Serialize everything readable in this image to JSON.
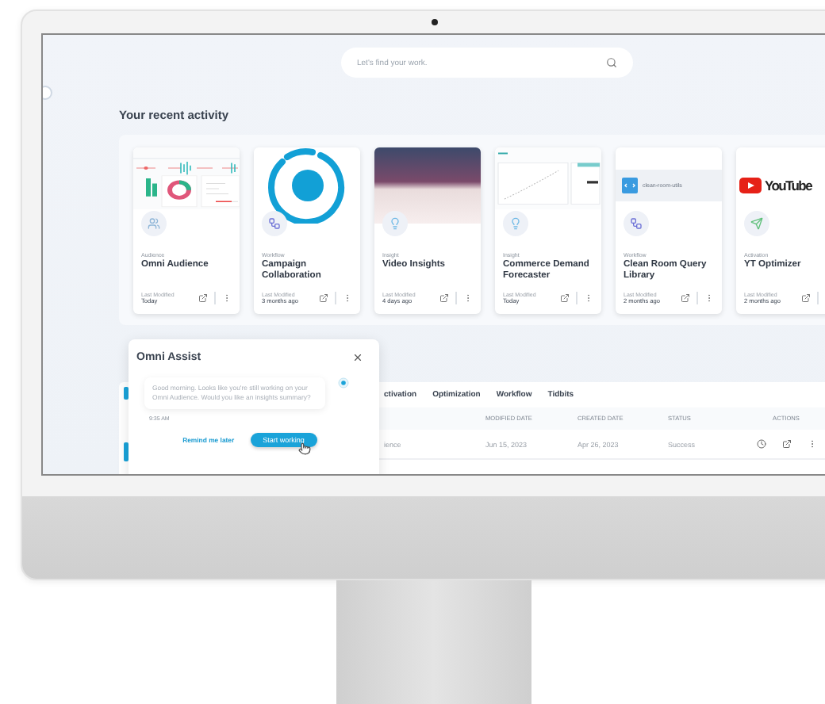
{
  "search": {
    "placeholder": "Let's find your work."
  },
  "recent_activity": {
    "title": "Your recent activity",
    "cards": [
      {
        "image": {
          "kind": "dashboard"
        },
        "kind": "audience",
        "category": "Audience",
        "title": "Omni Audience",
        "modified_label": "Last Modified",
        "modified": "Today"
      },
      {
        "image": {
          "kind": "ring-logo"
        },
        "kind": "workflow",
        "category": "Workflow",
        "title": "Campaign Collaboration",
        "modified_label": "Last Modified",
        "modified": "3 months ago"
      },
      {
        "image": {
          "kind": "photo"
        },
        "kind": "insight",
        "category": "Insight",
        "title": "Video Insights",
        "modified_label": "Last Modified",
        "modified": "4 days ago"
      },
      {
        "image": {
          "kind": "chart"
        },
        "kind": "insight",
        "category": "Insight",
        "title": "Commerce Demand Forecaster",
        "modified_label": "Last Modified",
        "modified": "Today"
      },
      {
        "image": {
          "kind": "file",
          "label": "clean-room-utils"
        },
        "kind": "workflow",
        "category": "Workflow",
        "title": "Clean Room Query Library",
        "modified_label": "Last Modified",
        "modified": "2 months ago"
      },
      {
        "image": {
          "kind": "video-logo",
          "label": "YouTube"
        },
        "kind": "activation",
        "category": "Activation",
        "title": "YT Optimizer",
        "modified_label": "Last Modified",
        "modified": "2 months ago"
      }
    ]
  },
  "table": {
    "tabs": [
      {
        "label": "ctivation"
      },
      {
        "label": "Optimization"
      },
      {
        "label": "Workflow"
      },
      {
        "label": "Tidbits"
      }
    ],
    "columns": [
      "MODIFIED DATE",
      "CREATED DATE",
      "STATUS",
      "ACTIONS"
    ],
    "rows": [
      {
        "name": "ience",
        "modified": "Jun 15, 2023",
        "created": "Apr 26, 2023",
        "status": "Success"
      }
    ]
  },
  "assistant": {
    "title": "Omni Assist",
    "message": "Good morning. Looks like you're still working on your Omni Audience. Would you like an insights summary?",
    "time": "9:35 AM",
    "secondary_action": "Remind me later",
    "primary_action": "Start working"
  }
}
